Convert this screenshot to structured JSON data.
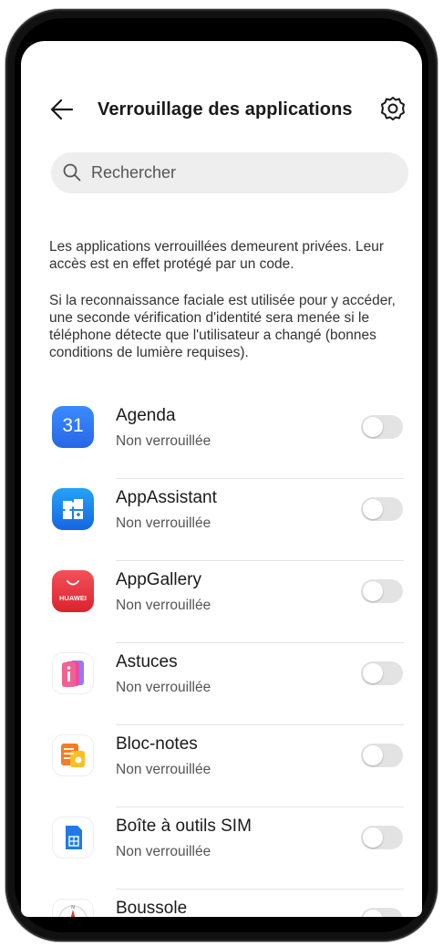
{
  "header": {
    "back_icon": "arrow-left-icon",
    "title": "Verrouillage des applications",
    "settings_icon": "gear-icon"
  },
  "search": {
    "icon": "search-icon",
    "placeholder": "Rechercher"
  },
  "description": {
    "paragraph1": "Les applications verrouillées demeurent privées. Leur accès est en effet protégé par un code.",
    "paragraph2": "Si la reconnaissance faciale est utilisée pour y accéder, une seconde vérification d'identité sera menée si le téléphone détecte que l'utilisateur a changé (bonnes conditions de lumière requises)."
  },
  "apps": [
    {
      "name": "Agenda",
      "status": "Non verrouillée",
      "icon": "calendar-icon",
      "icon_text": "31",
      "enabled": false
    },
    {
      "name": "AppAssistant",
      "status": "Non verrouillée",
      "icon": "puzzle-icon",
      "enabled": false
    },
    {
      "name": "AppGallery",
      "status": "Non verrouillée",
      "icon": "huawei-appgallery-icon",
      "icon_text": "HUAWEI",
      "enabled": false
    },
    {
      "name": "Astuces",
      "status": "Non verrouillée",
      "icon": "tips-icon",
      "enabled": false
    },
    {
      "name": "Bloc-notes",
      "status": "Non verrouillée",
      "icon": "notepad-icon",
      "enabled": false
    },
    {
      "name": "Boîte à outils SIM",
      "status": "Non verrouillée",
      "icon": "sim-card-icon",
      "enabled": false
    },
    {
      "name": "Boussole",
      "status": "",
      "icon": "compass-icon",
      "enabled": false
    }
  ],
  "colors": {
    "calendar_blue": "#2f7cf6",
    "appassistant_blue": "#1e88e5",
    "appgallery_red": "#e8343f",
    "toggle_off": "#e3e3e3"
  }
}
